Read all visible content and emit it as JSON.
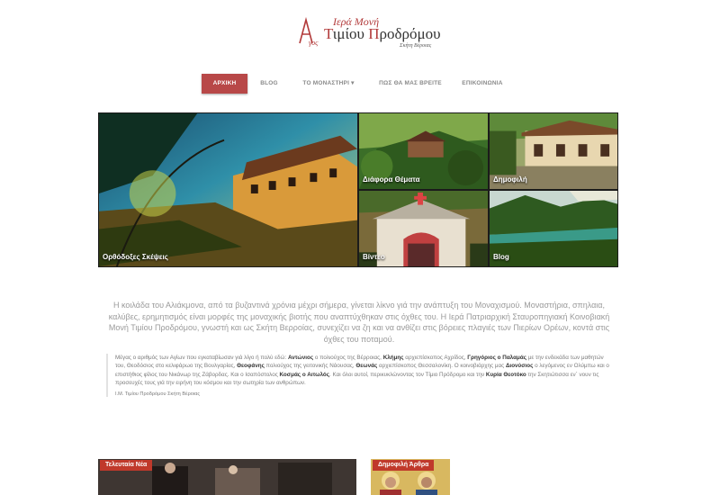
{
  "logo": {
    "line1": "Ιερά Μονή",
    "line2_first": "Τ",
    "line2_mid": "ιμίου ",
    "line2_second": "Π",
    "line2_rest": "ροδρόμου",
    "line3": "Σκήτη Βέροιας",
    "mark": "Αγιος"
  },
  "nav": {
    "items": [
      {
        "label": "ΑΡΧΙΚΗ"
      },
      {
        "label": "BLOG"
      },
      {
        "label": "ΤΟ ΜΟΝΑΣΤΗΡΙ ▾"
      },
      {
        "label": "ΠΩΣ ΘΑ ΜΑΣ ΒΡΕΙΤΕ"
      },
      {
        "label": "ΕΠΙΚΟΙΝΩΝΙΑ"
      }
    ]
  },
  "tiles": [
    {
      "label": "Ορθόδοξες Σκέψεις"
    },
    {
      "label": "Διάφορα Θέματα"
    },
    {
      "label": "Δημοφιλή"
    },
    {
      "label": "Βίντεο"
    },
    {
      "label": "Blog"
    }
  ],
  "intro": {
    "text": "Η κοιλάδα του Αλιάκμονα, από τα βυζαντινά χρόνια μέχρι σήμερα, γίνεται λίκνο γιά την ανάπτυξη του Μοναχισμού. Μοναστήρια, σπηλαια, καλύβες, ερημητισμός είναι μορφές της μοναχικής βιοτής που αναπτύχθηκαν στις όχθες του. Η Ιερά Πατριαρχική Σταυροπηγιακή Κοινοβιακή Μονή Τιμίου Προδρόμου, γνωστή και ως Σκήτη Βερροίας, συνεχίζει να ζη και να ανθίζει στις βόρειες πλαγιές των Πιερίων Ορέων, κοντά στις όχθες του ποταμού."
  },
  "quote": {
    "t1": "Μέγας ο αριθμός των Αγίων που εγκαταβίωσαν γιά λίγο ή πολύ εδώ: ",
    "b1": "Αντώνιος",
    "t2": " ο πολιούχος της Βέρροιας, ",
    "b2": "Κλήμης",
    "t3": " αρχιεπίσκοπος Αχρίδος, ",
    "b3": "Γρηγόριος ο Παλαμάς",
    "t4": " με την ενδεκάδα των μαθητών του, Θεοδόσιος στο κελιφάρωο της Βουλγαρίας, ",
    "b4": "Θεοφάνης",
    "t5": " πολιούχος της γειτονικής Νάουσας, ",
    "b5": "Θεωνάς",
    "t6": " αρχιεπίσκοπος Θεσσαλονίκη. Ο κοινοβιάρχης μας ",
    "b6": "Διονύσιος",
    "t7": " ο λεγόμενος εν Ολύμπω και ο επιστήθιος φίλος του Νικάνωρ της Ζάβορδας. Και ο Ισαπόστολος ",
    "b7": "Κοσμάς ο Αιτωλός",
    "t8": ". Και όλοι αυτοί, περικυκλώνοντας τον Τίμιο Πρόδρομο και την ",
    "b8": "Κυρία Θεοτόκο",
    "t9": " την Σκητιώτισσα εν΄ νουν τις προσευχές τους γιά την ειρήνη του κόσμου και την σωτηρία των ανθρώπων.",
    "source": "Ι.Μ. Τιμίου Προδρόμου Σκήτη Βέροιας"
  },
  "panels": [
    {
      "tag": "Τελευταία Νέα"
    },
    {
      "tag": "Δημοφιλή Άρθρα"
    }
  ],
  "colors": {
    "accent": "#b84848",
    "tag": "#c0392b"
  }
}
